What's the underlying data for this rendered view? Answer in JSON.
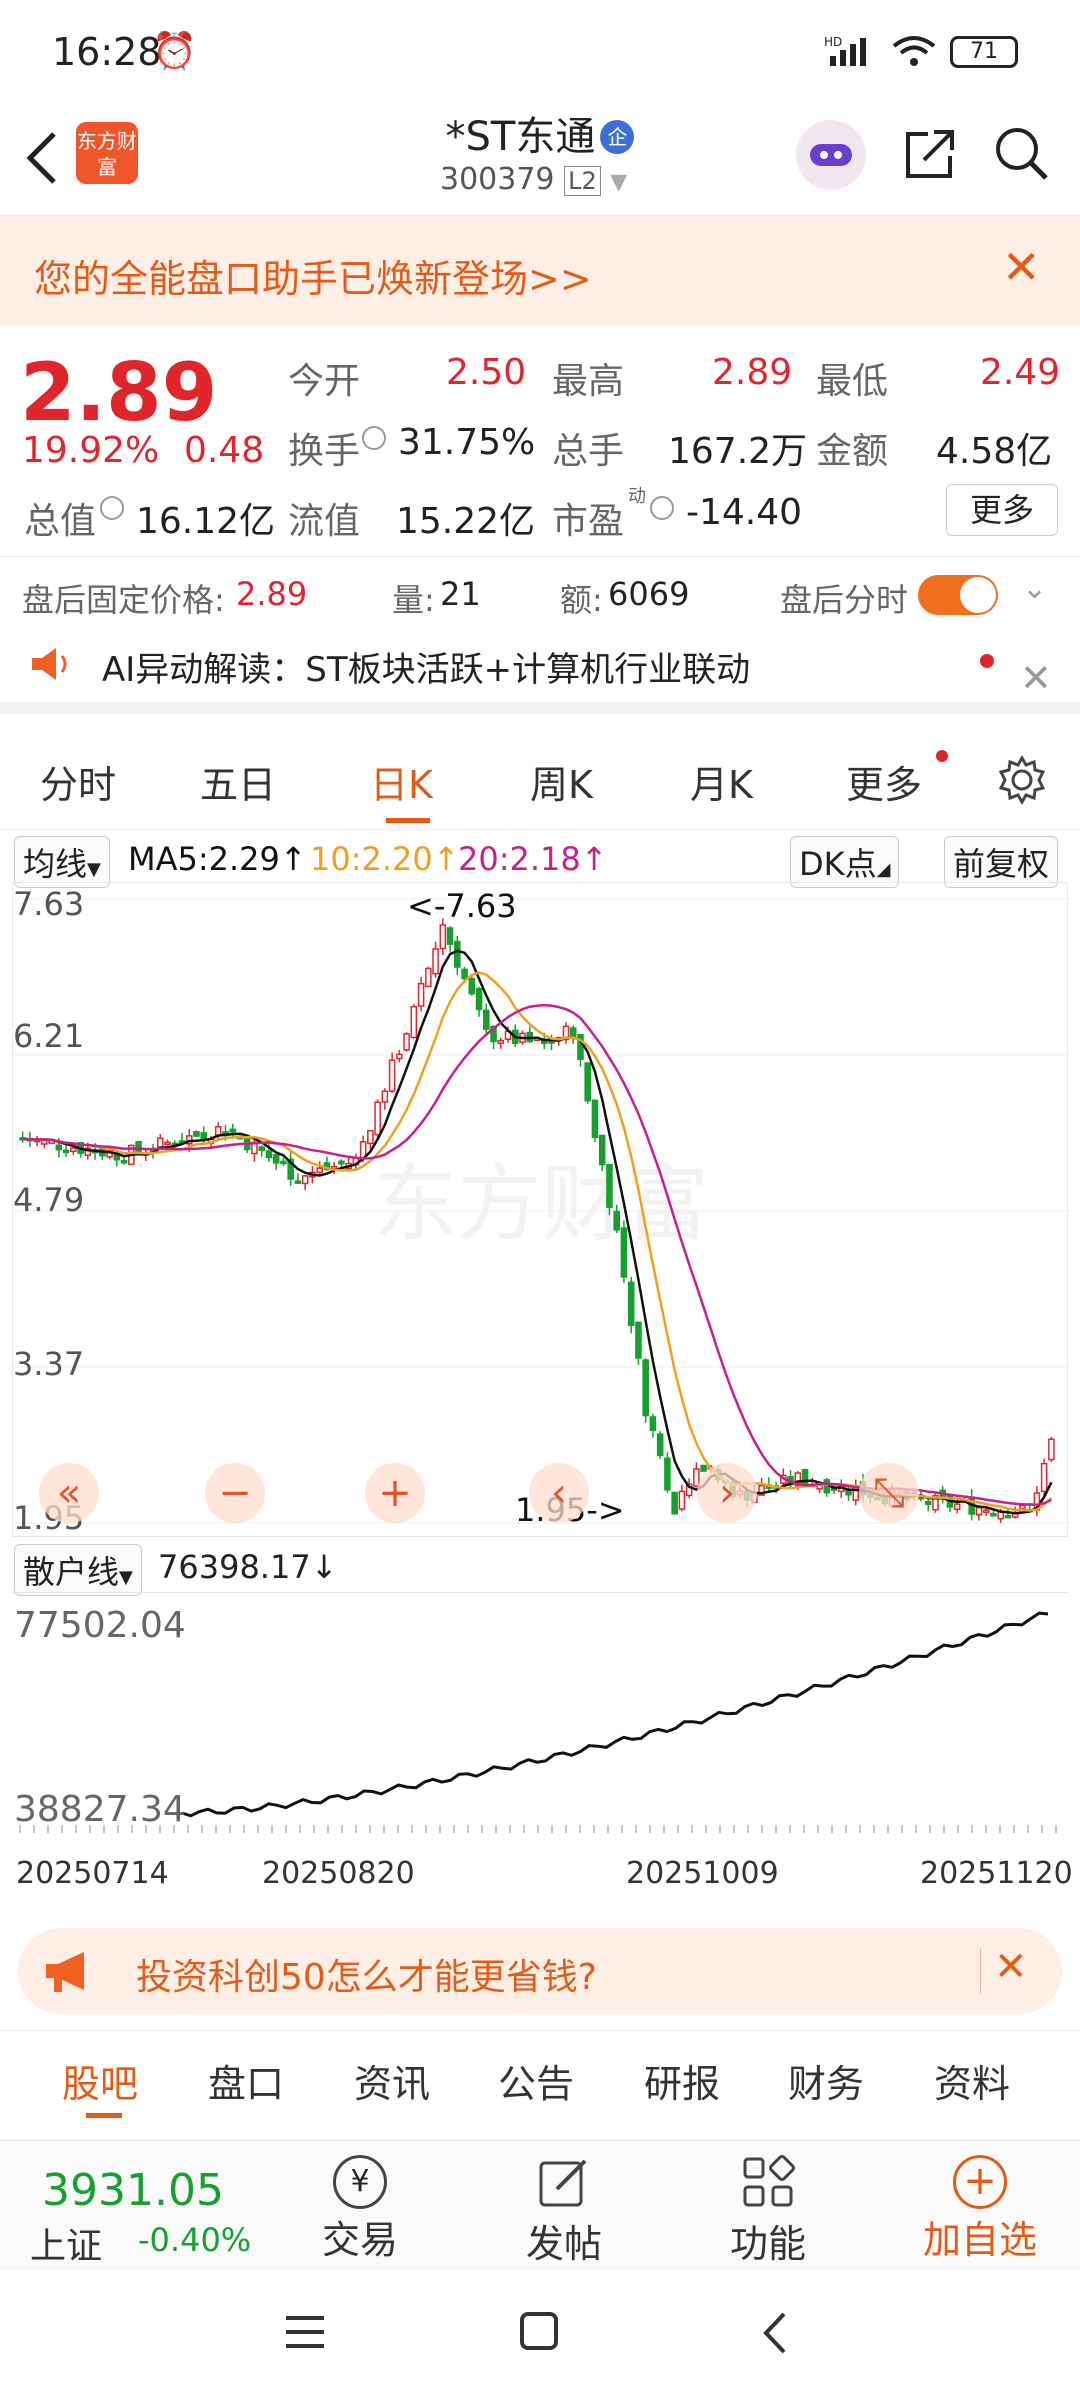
{
  "status_bar": {
    "time": "16:28",
    "battery": "71"
  },
  "header": {
    "logo_text": "东方财富",
    "title": "*ST东通",
    "badge": "企",
    "code": "300379",
    "level": "L2"
  },
  "banner": {
    "text": "您的全能盘口助手已焕新登场>>"
  },
  "quote": {
    "price": "2.89",
    "change_pct": "19.92%",
    "change": "0.48",
    "open_label": "今开",
    "open": "2.50",
    "high_label": "最高",
    "high": "2.89",
    "low_label": "最低",
    "low": "2.49",
    "turnover_label": "换手",
    "turnover": "31.75%",
    "volume_label": "总手",
    "volume": "167.2万",
    "amount_label": "金额",
    "amount": "4.58亿",
    "mktcap_label": "总值",
    "mktcap": "16.12亿",
    "float_label": "流值",
    "float": "15.22亿",
    "pe_label": "市盈",
    "pe_sup": "动",
    "pe": "-14.40",
    "more": "更多"
  },
  "after_hours": {
    "price_label": "盘后固定价格:",
    "price": "2.89",
    "qty_label": "量:",
    "qty": "21",
    "amt_label": "额:",
    "amt": "6069",
    "toggle_label": "盘后分时"
  },
  "ai_note": {
    "text": "AI异动解读：ST板块活跃+计算机行业联动"
  },
  "chart_tabs": [
    "分时",
    "五日",
    "日K",
    "周K",
    "月K",
    "更多"
  ],
  "ma": {
    "type": "均线",
    "ma5": "MA5:2.29",
    "ma10": "10:2.20",
    "ma20": "20:2.18",
    "dk": "DK点",
    "adjust": "前复权"
  },
  "chart_data": {
    "type": "candlestick",
    "y_ticks": [
      "7.63",
      "6.21",
      "4.79",
      "3.37",
      "1.95"
    ],
    "ylim": [
      1.95,
      7.63
    ],
    "annotations": [
      "<-7.63",
      "1.95->"
    ],
    "watermark": "东方财富",
    "colors": {
      "up": "#e0262c",
      "down": "#17a02f",
      "ma5": "#111111",
      "ma10": "#f0a020",
      "ma20": "#c8208a"
    }
  },
  "scatter": {
    "label": "散户线",
    "value": "76398.17",
    "ymax": "77502.04",
    "ymin": "38827.34",
    "dates": [
      "20250714",
      "20250820",
      "20251009",
      "20251120"
    ]
  },
  "ad": {
    "text": "投资科创50怎么才能更省钱?"
  },
  "sub_tabs": [
    "股吧",
    "盘口",
    "资讯",
    "公告",
    "研报",
    "财务",
    "资料"
  ],
  "bottom": {
    "index_value": "3931.05",
    "index_name": "上证",
    "index_change": "-0.40%",
    "trade": "交易",
    "post": "发帖",
    "func": "功能",
    "add": "加自选"
  }
}
